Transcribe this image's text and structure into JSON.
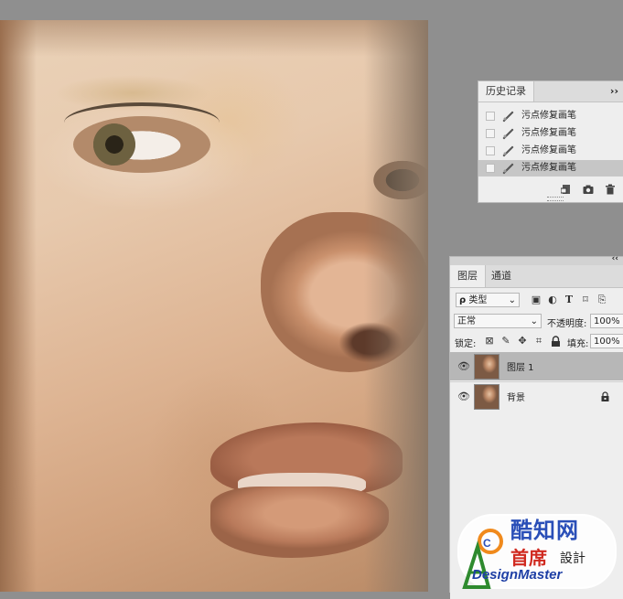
{
  "history_panel": {
    "title": "历史记录",
    "menu_glyph": "››",
    "items": [
      {
        "label": "污点修复画笔",
        "selected": false
      },
      {
        "label": "污点修复画笔",
        "selected": false
      },
      {
        "label": "污点修复画笔",
        "selected": false
      },
      {
        "label": "污点修复画笔",
        "selected": true
      }
    ],
    "icons": [
      "new-document-from-state-icon",
      "camera-icon",
      "trash-icon"
    ]
  },
  "layers_panel": {
    "collapse_glyph": "‹‹",
    "tabs": [
      {
        "label": "图层",
        "active": true
      },
      {
        "label": "通道",
        "active": false
      }
    ],
    "filter": {
      "search_glyph": "ρ",
      "value": "类型"
    },
    "filter_icons": [
      "image-filter-icon",
      "adjustment-filter-icon",
      "type-filter-icon",
      "shape-filter-icon",
      "smart-object-filter-icon"
    ],
    "blend_mode": "正常",
    "opacity_label": "不透明度:",
    "opacity_value": "100%",
    "lock_label": "锁定:",
    "fill_label": "填充:",
    "fill_value": "100%",
    "layers": [
      {
        "name": "图层 1",
        "selected": true,
        "locked": false
      },
      {
        "name": "背景",
        "selected": false,
        "locked": true
      }
    ]
  },
  "watermark": {
    "line1": "酷知网",
    "line2": "首席",
    "line2b": "設計",
    "line3": "DesignMaster"
  }
}
